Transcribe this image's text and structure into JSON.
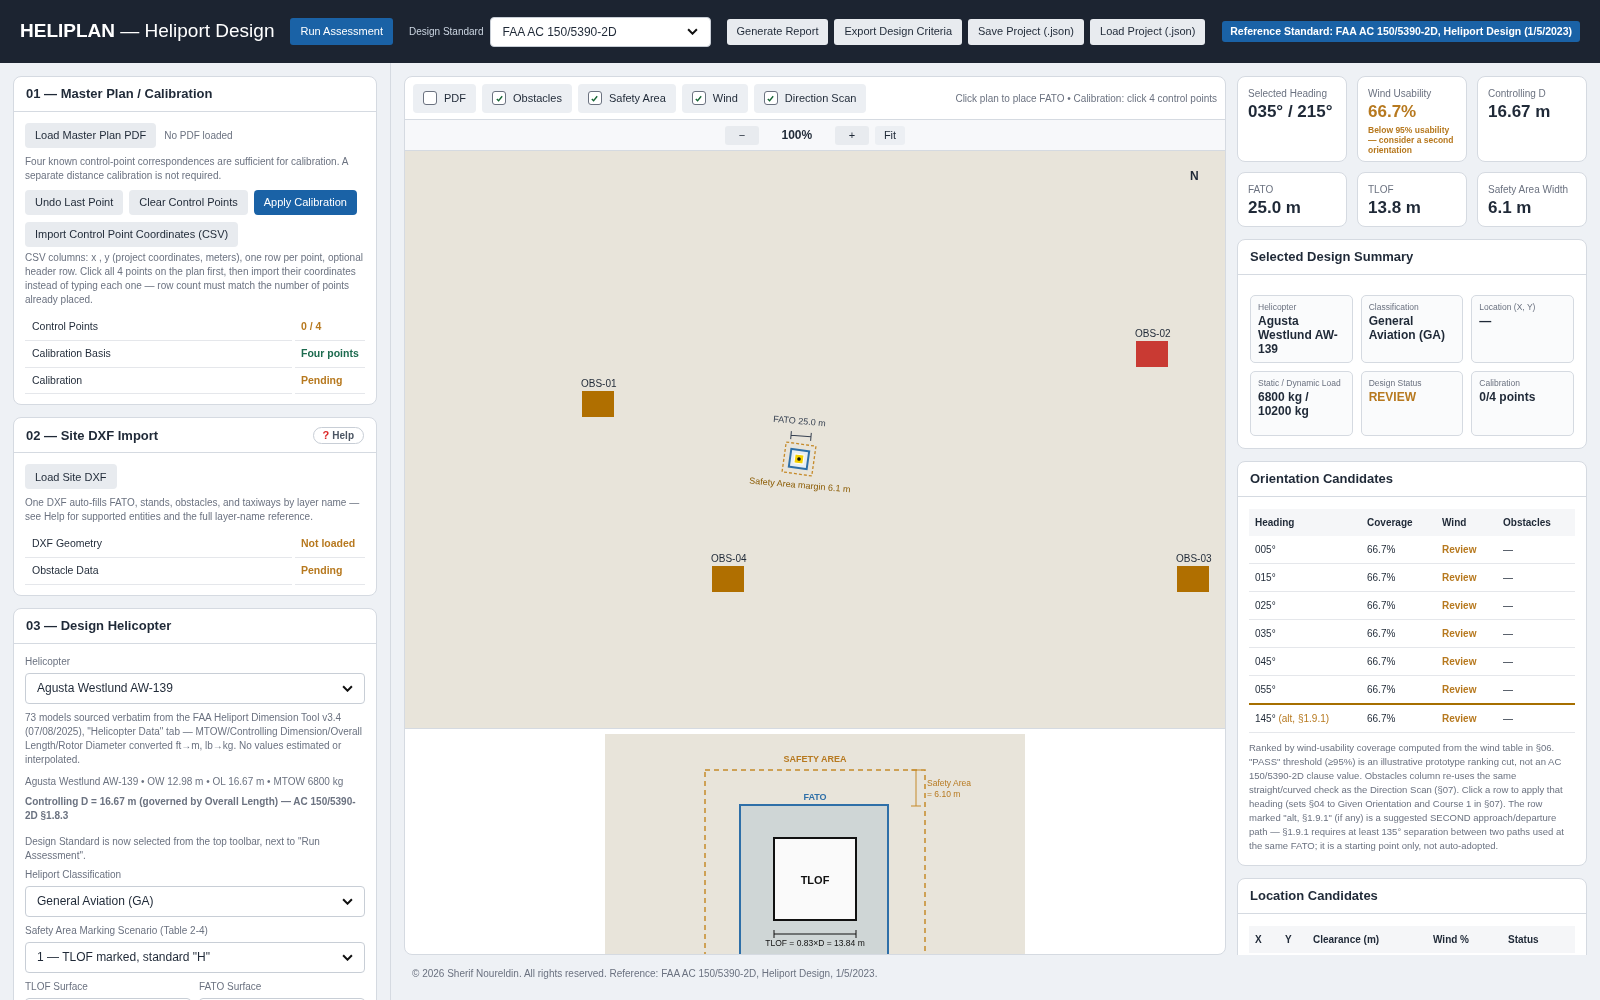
{
  "header": {
    "title": "**HELIPLAN** — Heliport Design",
    "run_button": "Run Assessment",
    "standard_label": "Design Standard",
    "standard_value": "FAA AC 150/5390-2D",
    "buttons": [
      "Generate Report",
      "Export Design Criteria",
      "Save Project (.json)",
      "Load Project (.json)"
    ],
    "reference": "Reference Standard: FAA AC 150/5390-2D, Heliport Design (1/5/2023)"
  },
  "panels": [
    {
      "kind": "calibration",
      "title": "01 — Master Plan / Calibration",
      "load_button": "Load Master Plan PDF",
      "load_status": "No PDF loaded",
      "note": "Four known control-point correspondences are sufficient for calibration. A separate distance calibration is not required.",
      "buttons": [
        {
          "label": "Undo Last Point",
          "primary": false
        },
        {
          "label": "Clear Control Points",
          "primary": false
        },
        {
          "label": "Apply Calibration",
          "primary": true
        }
      ],
      "import_button": "Import Control Point Coordinates (CSV)",
      "csv_note": "CSV columns: x , y (project coordinates, meters), one row per point, optional header row. Click all 4 points on the plan first, then import their coordinates instead of typing each one — row count must match the number of points already placed.",
      "status": [
        {
          "label": "Control Points",
          "value": "0 / 4",
          "color": "#b7791f"
        },
        {
          "label": "Calibration Basis",
          "value": "Four points",
          "color": "#1d6b4f"
        },
        {
          "label": "Calibration",
          "value": "Pending",
          "color": "#b7791f"
        }
      ]
    },
    {
      "kind": "dxf",
      "title": "02 — Site DXF Import",
      "help_icon": "?",
      "help_label": "Help",
      "load_button": "Load Site DXF",
      "note": "One DXF auto-fills FATO, stands, obstacles, and taxiways by layer name — see Help for supported entities and the full layer-name reference.",
      "status": [
        {
          "label": "DXF Geometry",
          "value": "Not loaded",
          "color": "#b7791f"
        },
        {
          "label": "Obstacle Data",
          "value": "Pending",
          "color": "#b7791f"
        }
      ]
    },
    {
      "kind": "helicopter",
      "title": "03 — Design Helicopter",
      "helicopter_label": "Helicopter",
      "helicopter_value": "Agusta Westlund AW-139",
      "source_note": "73 models sourced verbatim from the FAA Heliport Dimension Tool v3.4 (07/08/2025), \"Helicopter Data\" tab — MTOW/Controlling Dimension/Overall Length/Rotor Diameter converted ft→m, lb→kg. No values estimated or interpolated.",
      "spec_line": "Agusta Westlund AW-139 • OW 12.98 m • OL 16.67 m • MTOW 6800 kg",
      "controlling_line": "Controlling D = 16.67 m (governed by Overall Length) — AC 150/5390-2D §1.8.3",
      "standard_note": "Design Standard is now selected from the top toolbar, next to \"Run Assessment\".",
      "classification_label": "Heliport Classification",
      "classification_value": "General Aviation (GA)",
      "scenario_label": "Safety Area Marking Scenario (Table 2-4)",
      "scenario_value": "1 — TLOF marked, standard \"H\"",
      "tlof_surface_label": "TLOF Surface",
      "fato_surface_label": "FATO Surface"
    }
  ],
  "plan": {
    "layers": [
      {
        "label": "PDF",
        "checked": false
      },
      {
        "label": "Obstacles",
        "checked": true
      },
      {
        "label": "Safety Area",
        "checked": true
      },
      {
        "label": "Wind",
        "checked": true
      },
      {
        "label": "Direction Scan",
        "checked": true
      }
    ],
    "hint": "Click plan to place FATO • Calibration: click 4 control points",
    "zoom_out": "−",
    "zoom_level": "100%",
    "zoom_in": "+",
    "fit": "Fit",
    "north": "N",
    "obstacles": [
      {
        "label": "OBS-01",
        "color": "#b06f00"
      },
      {
        "label": "OBS-02",
        "color": "#c93a33"
      },
      {
        "label": "OBS-04",
        "color": "#b06f00"
      },
      {
        "label": "OBS-03",
        "color": "#b06f00"
      }
    ],
    "fato_label": "FATO 25.0 m",
    "safety_label": "Safety Area margin 6.1 m",
    "detail": {
      "safety_area": "SAFETY AREA",
      "fato": "FATO",
      "tlof": "TLOF",
      "tlof_dimension": "TLOF = 0.83×D = 13.84 m",
      "safety_dimension_1": "Safety Area",
      "safety_dimension_2": "= 6.10 m"
    }
  },
  "footer": "© 2026 Sherif Noureldin. All rights reserved. Reference: FAA AC 150/5390-2D, Heliport Design, 1/5/2023.",
  "kpis": [
    {
      "label": "Selected Heading",
      "value": "035° / 215°",
      "color": "#1f2937"
    },
    {
      "label": "Wind Usability",
      "value": "66.7%",
      "color": "#b7791f",
      "note": "Below 95% usability — consider a second orientation"
    },
    {
      "label": "Controlling D",
      "value": "16.67 m",
      "color": "#1f2937"
    },
    {
      "label": "FATO",
      "value": "25.0 m",
      "color": "#1f2937"
    },
    {
      "label": "TLOF",
      "value": "13.8 m",
      "color": "#1f2937"
    },
    {
      "label": "Safety Area Width",
      "value": "6.1 m",
      "color": "#1f2937"
    }
  ],
  "summary": {
    "title": "Selected Design Summary",
    "items": [
      {
        "label": "Helicopter",
        "value": "Agusta Westlund AW-139",
        "color": "#1f2937"
      },
      {
        "label": "Classification",
        "value": "General Aviation (GA)",
        "color": "#1f2937"
      },
      {
        "label": "Location (X, Y)",
        "value": "—",
        "color": "#1f2937"
      },
      {
        "label": "Static / Dynamic Load",
        "value": "6800 kg / 10200 kg",
        "color": "#1f2937"
      },
      {
        "label": "Design Status",
        "value": "REVIEW",
        "color": "#b7791f"
      },
      {
        "label": "Calibration",
        "value": "0/4 points",
        "color": "#1f2937"
      }
    ]
  },
  "orientation": {
    "title": "Orientation Candidates",
    "columns": [
      "Heading",
      "Coverage",
      "Wind",
      "Obstacles"
    ],
    "rows": [
      {
        "kind": "ranked",
        "heading": "005°",
        "coverage": "66.7%",
        "wind": "Review",
        "obstacles": "—"
      },
      {
        "kind": "ranked",
        "heading": "015°",
        "coverage": "66.7%",
        "wind": "Review",
        "obstacles": "—"
      },
      {
        "kind": "ranked",
        "heading": "025°",
        "coverage": "66.7%",
        "wind": "Review",
        "obstacles": "—"
      },
      {
        "kind": "ranked",
        "heading": "035°",
        "coverage": "66.7%",
        "wind": "Review",
        "obstacles": "—"
      },
      {
        "kind": "ranked",
        "heading": "045°",
        "coverage": "66.7%",
        "wind": "Review",
        "obstacles": "—"
      },
      {
        "kind": "ranked",
        "heading": "055°",
        "coverage": "66.7%",
        "wind": "Review",
        "obstacles": "—"
      },
      {
        "kind": "alt",
        "heading": "145°",
        "alt_note": "(alt, §1.9.1)",
        "coverage": "66.7%",
        "wind": "Review",
        "obstacles": "—"
      }
    ],
    "note": "Ranked by wind-usability coverage computed from the wind table in §06. \"PASS\" threshold (≥95%) is an illustrative prototype ranking cut, not an AC 150/5390-2D clause value. Obstacles column re-uses the same straight/curved check as the Direction Scan (§07). Click a row to apply that heading (sets §04 to Given Orientation and Course 1 in §07). The row marked \"alt, §1.9.1\" (if any) is a suggested SECOND approach/departure path — §1.9.1 requires at least 135° separation between two paths used at the same FATO; it is a starting point only, not auto-adopted."
  },
  "locations": {
    "title": "Location Candidates",
    "columns": [
      "X",
      "Y",
      "Clearance (m)",
      "Wind %",
      "Status"
    ]
  }
}
